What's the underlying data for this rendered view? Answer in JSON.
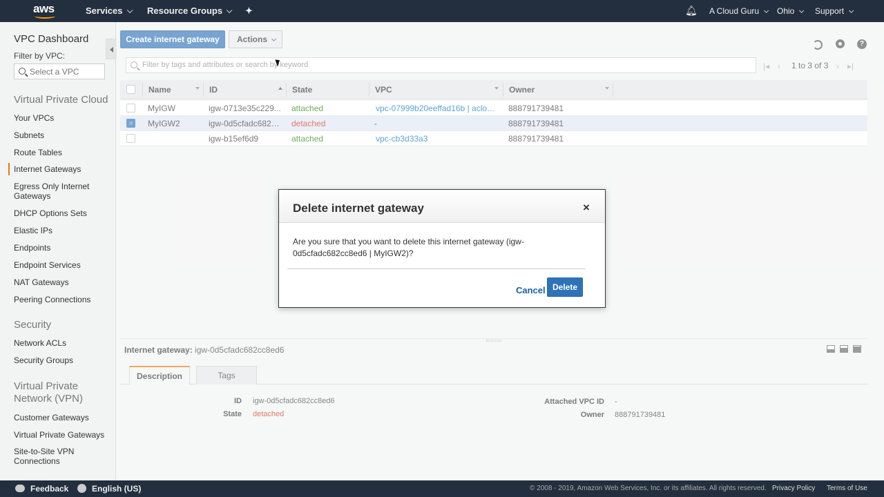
{
  "topnav": {
    "logo_text": "aws",
    "services": "Services",
    "resource_groups": "Resource Groups",
    "account": "A Cloud Guru",
    "region": "Ohio",
    "support": "Support"
  },
  "sidebar": {
    "title": "VPC Dashboard",
    "filter_label": "Filter by VPC:",
    "select_placeholder": "Select a VPC",
    "sections": [
      {
        "title": "Virtual Private Cloud"
      },
      {
        "title": "Security"
      },
      {
        "title": "Virtual Private Network (VPN)"
      }
    ],
    "links": [
      "Your VPCs",
      "Subnets",
      "Route Tables",
      "Internet Gateways",
      "Egress Only Internet Gateways",
      "DHCP Options Sets",
      "Elastic IPs",
      "Endpoints",
      "Endpoint Services",
      "NAT Gateways",
      "Peering Connections",
      "Network ACLs",
      "Security Groups",
      "Customer Gateways",
      "Virtual Private Gateways",
      "Site-to-Site VPN Connections"
    ]
  },
  "toolbar": {
    "create_label": "Create internet gateway",
    "actions_label": "Actions",
    "filter_placeholder": "Filter by tags and attributes or search by keyword",
    "pager_text": "1 to 3 of 3"
  },
  "table": {
    "headers": [
      "Name",
      "ID",
      "State",
      "VPC",
      "Owner"
    ],
    "rows": [
      {
        "name": "MyIGW",
        "id": "igw-0713e35c229...",
        "state": "attached",
        "vpc": "vpc-07999b20eeffad16b | acloud...",
        "owner": "888791739481",
        "selected": false
      },
      {
        "name": "MyIGW2",
        "id": "igw-0d5cfadc682c...",
        "state": "detached",
        "vpc": "-",
        "owner": "888791739481",
        "selected": true
      },
      {
        "name": "",
        "id": "igw-b15ef6d9",
        "state": "attached",
        "vpc": "vpc-cb3d33a3",
        "owner": "888791739481",
        "selected": false
      }
    ]
  },
  "modal": {
    "title": "Delete internet gateway",
    "close": "×",
    "message": "Are you sure that you want to delete this internet gateway (igw-0d5cfadc682cc8ed6 | MyIGW2)?",
    "cancel": "Cancel",
    "delete": "Delete"
  },
  "detail": {
    "label": "Internet gateway:",
    "value": "igw-0d5cfadc682cc8ed6",
    "tabs": [
      "Description",
      "Tags"
    ],
    "fields": {
      "id_label": "ID",
      "id_value": "igw-0d5cfadc682cc8ed6",
      "state_label": "State",
      "state_value": "detached",
      "vpc_label": "Attached VPC ID",
      "vpc_value": "-",
      "owner_label": "Owner",
      "owner_value": "888791739481"
    }
  },
  "footer": {
    "feedback": "Feedback",
    "language": "English (US)",
    "copyright": "© 2008 - 2019, Amazon Web Services, Inc. or its affiliates. All rights reserved.",
    "privacy": "Privacy Policy",
    "terms": "Terms of Use"
  },
  "colors": {
    "accent": "#e47911",
    "primary": "#2e73b8",
    "attached": "#1d8102",
    "detached": "#d13212",
    "link": "#0073bb",
    "nav_bg": "#232f3e"
  }
}
